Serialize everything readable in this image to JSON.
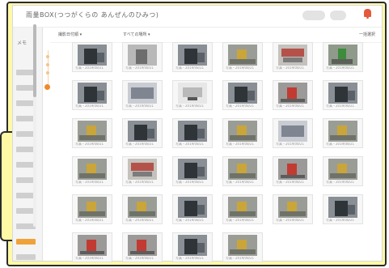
{
  "header": {
    "title": "雨量BOX(つつがくらの あんぜんのひみつ)"
  },
  "toolbar": {
    "sort_label": "撮影日付順",
    "filter_label": "すべての場所",
    "right_label": "一括選択"
  },
  "sidebar": {
    "title": "メモ",
    "item_count": 13,
    "active_index": 11
  },
  "colors": {
    "frame": "#fff9a6",
    "accent": "#f0a23a",
    "alert": "#e45a3c"
  },
  "photos": [
    {
      "kind": "dark-scene",
      "caption": "写真・2019/08/21"
    },
    {
      "kind": "bw",
      "caption": "写真・2019/08/21"
    },
    {
      "kind": "dark-scene",
      "caption": "写真・2019/08/21"
    },
    {
      "kind": "yellow-object",
      "caption": "写真・2019/08/21"
    },
    {
      "kind": "sign-red",
      "caption": "写真・2019/08/21"
    },
    {
      "kind": "green-object",
      "caption": "写真・2019/08/21"
    },
    {
      "kind": "dark-scene",
      "caption": "写真・2019/08/21"
    },
    {
      "kind": "document",
      "caption": "写真・2019/08/21"
    },
    {
      "kind": "light-document",
      "caption": "写真・2019/08/21"
    },
    {
      "kind": "dark-scene",
      "caption": "写真・2019/08/21"
    },
    {
      "kind": "red-object",
      "caption": "写真・2019/08/21"
    },
    {
      "kind": "dark-scene",
      "caption": "写真・2019/08/21"
    },
    {
      "kind": "yellow-object",
      "caption": "写真・2019/08/21"
    },
    {
      "kind": "dark-scene",
      "caption": "写真・2019/08/21"
    },
    {
      "kind": "dark-scene",
      "caption": "写真・2019/08/21"
    },
    {
      "kind": "yellow-object",
      "caption": "写真・2019/08/21"
    },
    {
      "kind": "document",
      "caption": "写真・2019/08/21"
    },
    {
      "kind": "yellow-object",
      "caption": "写真・2019/08/21"
    },
    {
      "kind": "yellow-object",
      "caption": "写真・2019/08/21"
    },
    {
      "kind": "sign-red",
      "caption": "写真・2019/08/21"
    },
    {
      "kind": "dark-scene",
      "caption": "写真・2019/08/21"
    },
    {
      "kind": "yellow-object",
      "caption": "写真・2019/08/21"
    },
    {
      "kind": "red-object",
      "caption": "写真・2019/08/21"
    },
    {
      "kind": "yellow-object",
      "caption": "写真・2019/08/21"
    },
    {
      "kind": "yellow-object",
      "caption": "写真・2019/08/21"
    },
    {
      "kind": "yellow-object",
      "caption": "写真・2019/08/21"
    },
    {
      "kind": "dark-scene",
      "caption": "写真・2019/08/21"
    },
    {
      "kind": "yellow-object",
      "caption": "写真・2019/08/21"
    },
    {
      "kind": "yellow-object",
      "caption": "写真・2019/08/21"
    },
    {
      "kind": "dark-scene",
      "caption": "写真・2019/08/21"
    },
    {
      "kind": "red-object",
      "caption": "写真・2019/08/21"
    },
    {
      "kind": "red-object",
      "caption": "写真・2019/08/21"
    },
    {
      "kind": "dark-scene",
      "caption": "写真・2019/08/21"
    },
    {
      "kind": "yellow-object",
      "caption": "写真・2019/08/21"
    }
  ]
}
